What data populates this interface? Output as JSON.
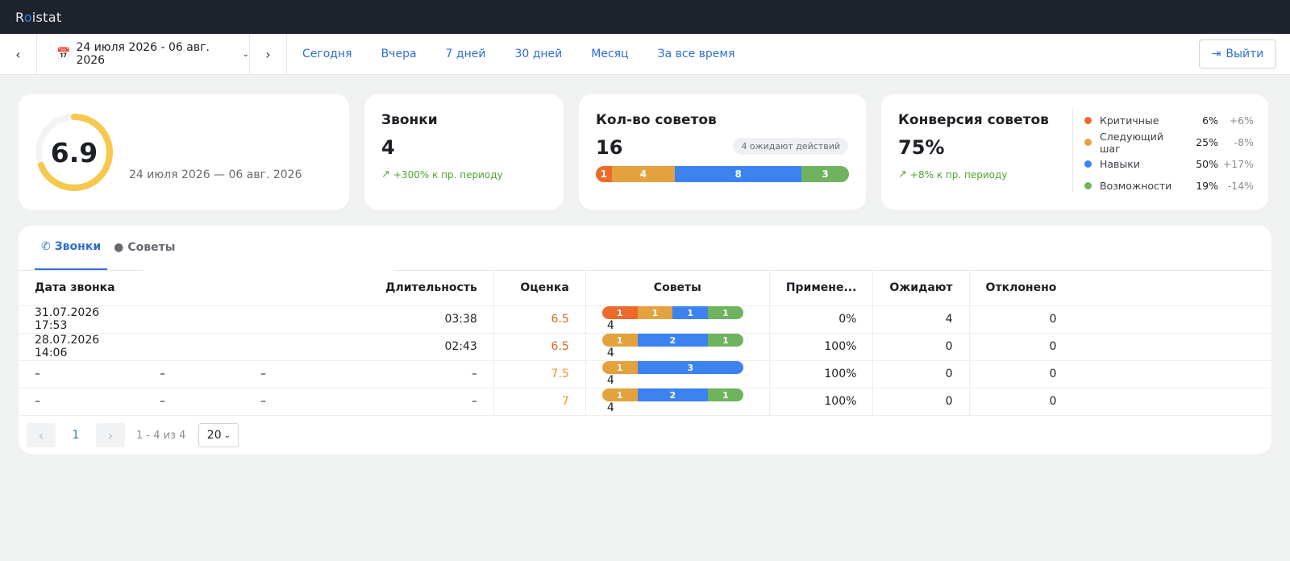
{
  "app": {
    "logo_r": "R",
    "logo_o": "o",
    "logo_rest": "istat"
  },
  "nav": {
    "date_range": "24 июля 2026 - 06 авг. 2026",
    "links": [
      "Сегодня",
      "Вчера",
      "7 дней",
      "30 дней",
      "Месяц",
      "За все время"
    ],
    "logout": "Выйти"
  },
  "score_card": {
    "value": "6.9",
    "range": "24 июля 2026 — 06 авг. 2026",
    "fraction": 0.69
  },
  "calls_card": {
    "title": "Звонки",
    "value": "4",
    "delta": "+300% к пр. периоду"
  },
  "tips_card": {
    "title": "Кол-во советов",
    "value": "16",
    "awaiting": "4 ожидают действий",
    "segments": [
      {
        "value": 1,
        "label": "1",
        "color": "#ee6a2a"
      },
      {
        "value": 4,
        "label": "4",
        "color": "#e4a23f"
      },
      {
        "value": 8,
        "label": "8",
        "color": "#3c83f0"
      },
      {
        "value": 3,
        "label": "3",
        "color": "#6fb35e"
      }
    ]
  },
  "conversion_card": {
    "title": "Конверсия советов",
    "value": "75%",
    "delta": "+8% к пр. периоду",
    "legend": [
      {
        "name": "Критичные",
        "pct": "6%",
        "delta": "+6%",
        "color": "#ee6a2a"
      },
      {
        "name": "Следующий шаг",
        "pct": "25%",
        "delta": "-8%",
        "color": "#e4a23f"
      },
      {
        "name": "Навыки",
        "pct": "50%",
        "delta": "+17%",
        "color": "#3c83f0"
      },
      {
        "name": "Возможности",
        "pct": "19%",
        "delta": "-14%",
        "color": "#6fb35e"
      }
    ]
  },
  "tabs": [
    "Звонки",
    "Советы"
  ],
  "table": {
    "headers": {
      "date": "Дата звонка",
      "duration": "Длительность",
      "score": "Оценка",
      "tips": "Советы",
      "applied": "Примене...",
      "waiting": "Ожидают",
      "declined": "Отклонено"
    },
    "rows": [
      {
        "date": "31.07.2026 17:53",
        "c2": "",
        "c3": "",
        "duration": "03:38",
        "score": "6.5",
        "tone": "o",
        "tips": [
          1,
          1,
          1,
          1
        ],
        "total": "4",
        "applied": "0%",
        "waiting": "4",
        "declined": "0"
      },
      {
        "date": "28.07.2026 14:06",
        "c2": "",
        "c3": "",
        "duration": "02:43",
        "score": "6.5",
        "tone": "o",
        "tips": [
          0,
          1,
          2,
          1
        ],
        "total": "4",
        "applied": "100%",
        "waiting": "0",
        "declined": "0"
      },
      {
        "date": "–",
        "c2": "–",
        "c3": "–",
        "duration": "–",
        "score": "7.5",
        "tone": "y",
        "tips": [
          0,
          1,
          3,
          0
        ],
        "total": "4",
        "applied": "100%",
        "waiting": "0",
        "declined": "0"
      },
      {
        "date": "–",
        "c2": "–",
        "c3": "–",
        "duration": "–",
        "score": "7",
        "tone": "y",
        "tips": [
          0,
          1,
          2,
          1
        ],
        "total": "4",
        "applied": "100%",
        "waiting": "0",
        "declined": "0"
      }
    ]
  },
  "pager": {
    "page": "1",
    "info": "1 - 4 из 4",
    "size": "20"
  }
}
